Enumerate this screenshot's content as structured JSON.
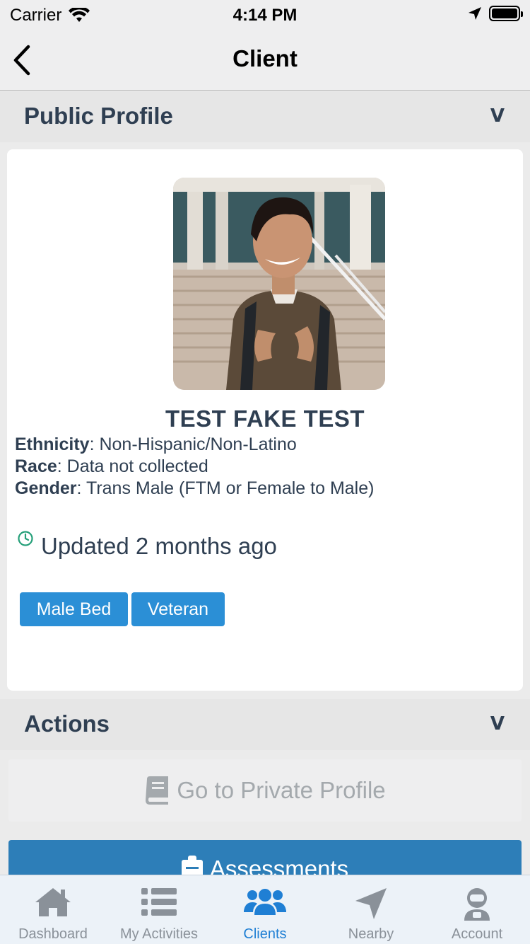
{
  "status_bar": {
    "carrier": "Carrier",
    "time": "4:14 PM"
  },
  "nav": {
    "title": "Client"
  },
  "public_profile": {
    "section_title": "Public Profile",
    "chevron": "V",
    "name": "TEST FAKE TEST",
    "details": [
      {
        "label": "Ethnicity",
        "value": ": Non-Hispanic/Non-Latino"
      },
      {
        "label": "Race",
        "value": ": Data not collected"
      },
      {
        "label": "Gender",
        "value": ": Trans Male (FTM or Female to Male)"
      }
    ],
    "updated": "Updated 2 months ago",
    "tags": [
      "Male Bed",
      "Veteran"
    ]
  },
  "actions": {
    "section_title": "Actions",
    "chevron": "V",
    "private_profile_label": "Go to Private Profile",
    "assessments_label": "Assessments"
  },
  "tabs": [
    {
      "label": "Dashboard",
      "icon": "home-icon"
    },
    {
      "label": "My Activities",
      "icon": "list-icon"
    },
    {
      "label": "Clients",
      "icon": "users-icon",
      "active": true
    },
    {
      "label": "Nearby",
      "icon": "location-arrow-icon"
    },
    {
      "label": "Account",
      "icon": "astronaut-icon"
    }
  ],
  "colors": {
    "accent": "#1f7fd4",
    "tag_bg": "#2b8fd6",
    "assess_bg": "#2d7eb8",
    "updated_icon": "#26a07a"
  }
}
